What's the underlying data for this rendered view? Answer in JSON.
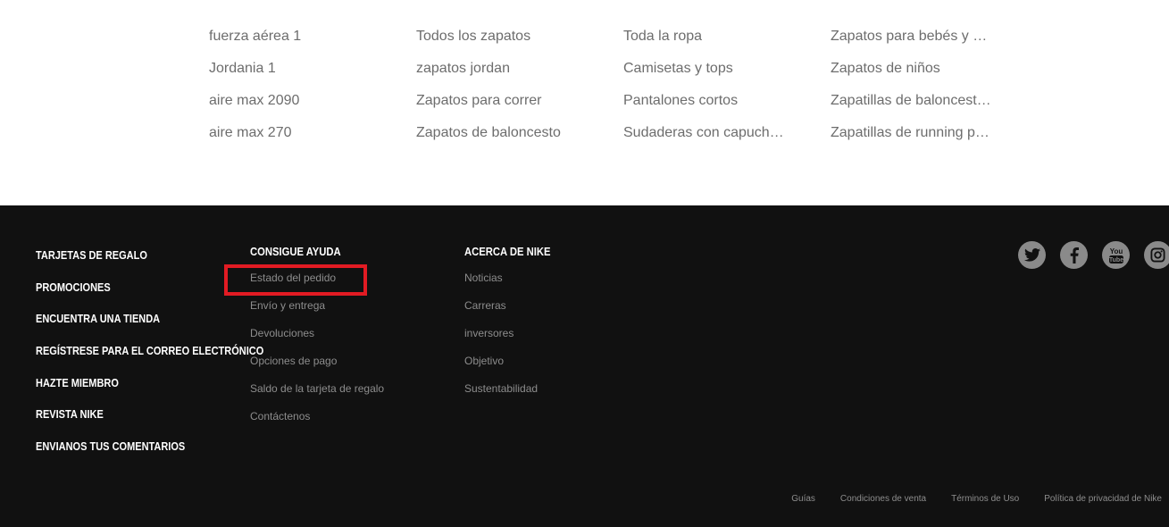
{
  "top_links": {
    "col1": [
      "fuerza aérea 1",
      "Jordania 1",
      "aire max 2090",
      "aire max 270"
    ],
    "col2": [
      "Todos los zapatos",
      "zapatos jordan",
      "Zapatos para correr",
      "Zapatos de baloncesto"
    ],
    "col3": [
      "Toda la ropa",
      "Camisetas y tops",
      "Pantalones cortos",
      "Sudaderas con capuch…"
    ],
    "col4": [
      "Zapatos para bebés y …",
      "Zapatos de niños",
      "Zapatillas de baloncest…",
      "Zapatillas de running p…"
    ]
  },
  "footer": {
    "main_items": [
      "TARJETAS DE REGALO",
      "PROMOCIONES",
      "ENCUENTRA UNA TIENDA",
      "REGÍSTRESE PARA EL CORREO ELECTRÓNICO",
      "HAZTE MIEMBRO",
      "REVISTA NIKE",
      "ENVIANOS TUS COMENTARIOS"
    ],
    "help": {
      "heading": "CONSIGUE AYUDA",
      "items": [
        "Estado del pedido",
        "Envío y entrega",
        "Devoluciones",
        "Opciones de pago",
        "Saldo de la tarjeta de regalo",
        "Contáctenos"
      ]
    },
    "about": {
      "heading": "ACERCA DE NIKE",
      "items": [
        "Noticias",
        "Carreras",
        "inversores",
        "Objetivo",
        "Sustentabilidad"
      ]
    },
    "social": [
      "twitter-icon",
      "facebook-icon",
      "youtube-icon",
      "instagram-icon"
    ],
    "legal": [
      "Guías",
      "Condiciones de venta",
      "Términos de Uso",
      "Política de privacidad de Nike"
    ],
    "highlight_color": "#e21b23",
    "background_color": "#111111"
  }
}
